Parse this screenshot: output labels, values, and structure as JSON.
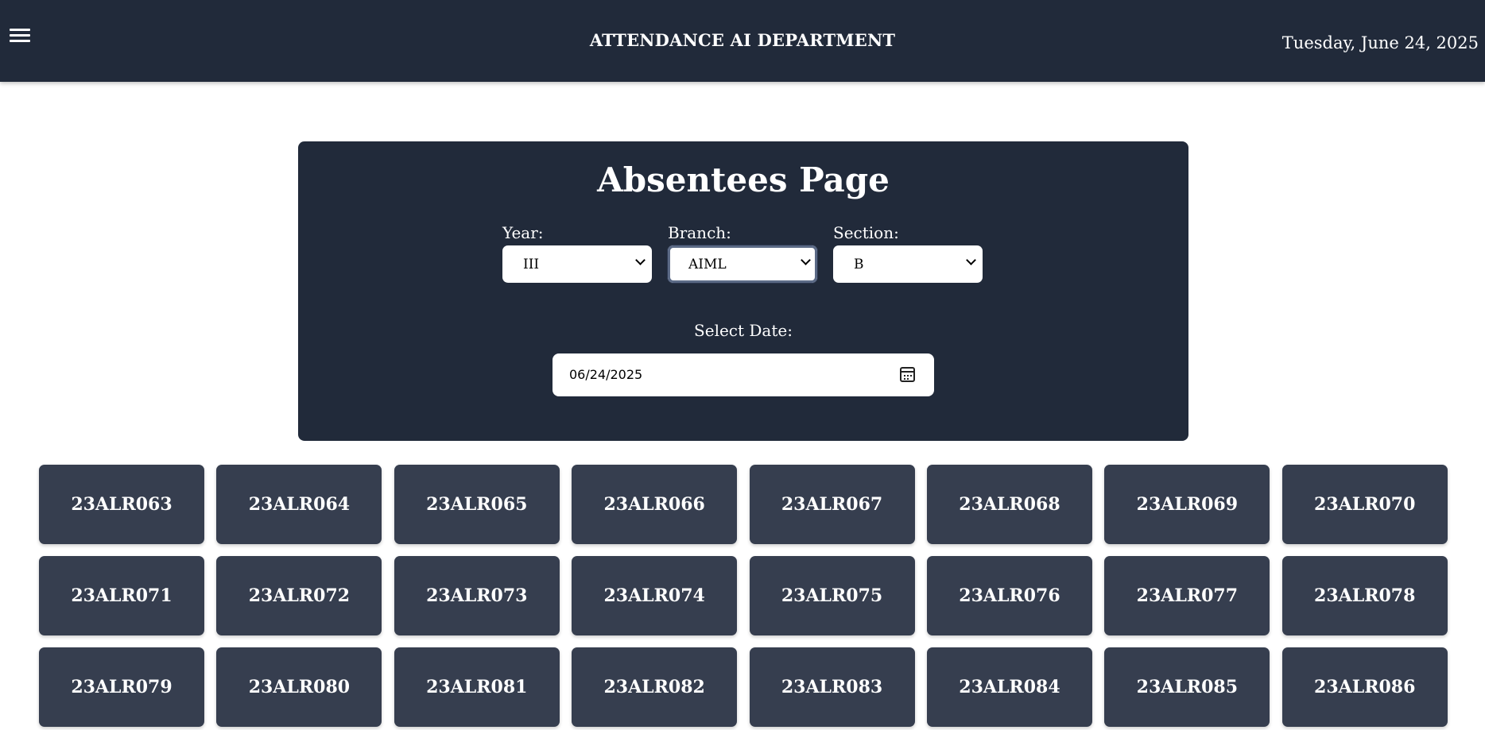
{
  "header": {
    "title": "ATTENDANCE AI DEPARTMENT",
    "date": "Tuesday, June 24, 2025",
    "menu_icon": "hamburger-icon"
  },
  "panel": {
    "title": "Absentees Page",
    "year": {
      "label": "Year:",
      "value": "III"
    },
    "branch": {
      "label": "Branch:",
      "value": "AIML"
    },
    "section": {
      "label": "Section:",
      "value": "B"
    },
    "date_label": "Select Date:",
    "date_value": "06/24/2025"
  },
  "roll_numbers": [
    "23ALR063",
    "23ALR064",
    "23ALR065",
    "23ALR066",
    "23ALR067",
    "23ALR068",
    "23ALR069",
    "23ALR070",
    "23ALR071",
    "23ALR072",
    "23ALR073",
    "23ALR074",
    "23ALR075",
    "23ALR076",
    "23ALR077",
    "23ALR078",
    "23ALR079",
    "23ALR080",
    "23ALR081",
    "23ALR082",
    "23ALR083",
    "23ALR084",
    "23ALR085",
    "23ALR086"
  ],
  "colors": {
    "header_bg": "#212a3a",
    "panel_bg": "#212a3a",
    "roll_bg": "#363e4f"
  }
}
